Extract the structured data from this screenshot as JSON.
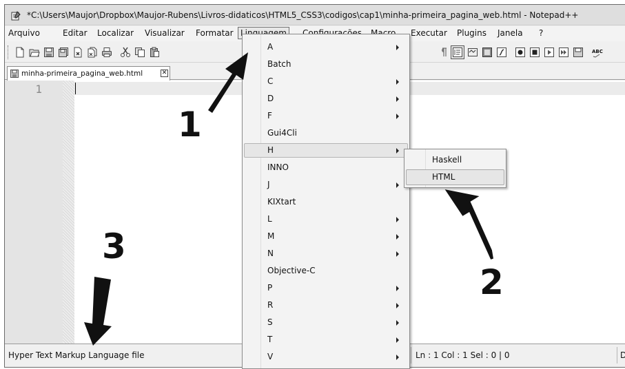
{
  "window": {
    "title": "*C:\\Users\\Maujor\\Dropbox\\Maujor-Rubens\\Livros-didaticos\\HTML5_CSS3\\codigos\\cap1\\minha-primeira_pagina_web.html - Notepad++"
  },
  "menubar": {
    "items": [
      {
        "label": "Arquivo"
      },
      {
        "label": "Editar"
      },
      {
        "label": "Localizar"
      },
      {
        "label": "Visualizar"
      },
      {
        "label": "Formatar"
      },
      {
        "label": "Linguagem"
      },
      {
        "label": "Configurações"
      },
      {
        "label": "Macro"
      },
      {
        "label": "Executar"
      },
      {
        "label": "Plugins"
      },
      {
        "label": "Janela"
      },
      {
        "label": "?"
      }
    ]
  },
  "tab": {
    "name": "minha-primeira_pagina_web.html",
    "close_glyph": "✕"
  },
  "editor": {
    "line_number": "1"
  },
  "language_menu": {
    "items": [
      {
        "label": "A",
        "submenu": true
      },
      {
        "label": "Batch",
        "submenu": false
      },
      {
        "label": "C",
        "submenu": true
      },
      {
        "label": "D",
        "submenu": true
      },
      {
        "label": "F",
        "submenu": true
      },
      {
        "label": "Gui4Cli",
        "submenu": false
      },
      {
        "label": "H",
        "submenu": true,
        "highlighted": true
      },
      {
        "label": "INNO",
        "submenu": false
      },
      {
        "label": "J",
        "submenu": true
      },
      {
        "label": "KIXtart",
        "submenu": false
      },
      {
        "label": "L",
        "submenu": true
      },
      {
        "label": "M",
        "submenu": true
      },
      {
        "label": "N",
        "submenu": true
      },
      {
        "label": "Objective-C",
        "submenu": false
      },
      {
        "label": "P",
        "submenu": true
      },
      {
        "label": "R",
        "submenu": true
      },
      {
        "label": "S",
        "submenu": true
      },
      {
        "label": "T",
        "submenu": true
      },
      {
        "label": "V",
        "submenu": true
      }
    ]
  },
  "h_submenu": {
    "items": [
      {
        "label": "Haskell",
        "highlighted": false
      },
      {
        "label": "HTML",
        "highlighted": true
      }
    ]
  },
  "statusbar": {
    "file_type": "Hyper Text Markup Language file",
    "position": "Ln : 1    Col : 1    Sel : 0 | 0",
    "eol_initial": "D"
  },
  "toolbar": {
    "spellcheck_label": "ABC"
  },
  "callouts": {
    "one": "1",
    "two": "2",
    "three": "3"
  },
  "colors": {
    "menu_highlight": "#e6e6e6",
    "current_line": "#ebebeb",
    "gutter": "#e4e4e4"
  }
}
